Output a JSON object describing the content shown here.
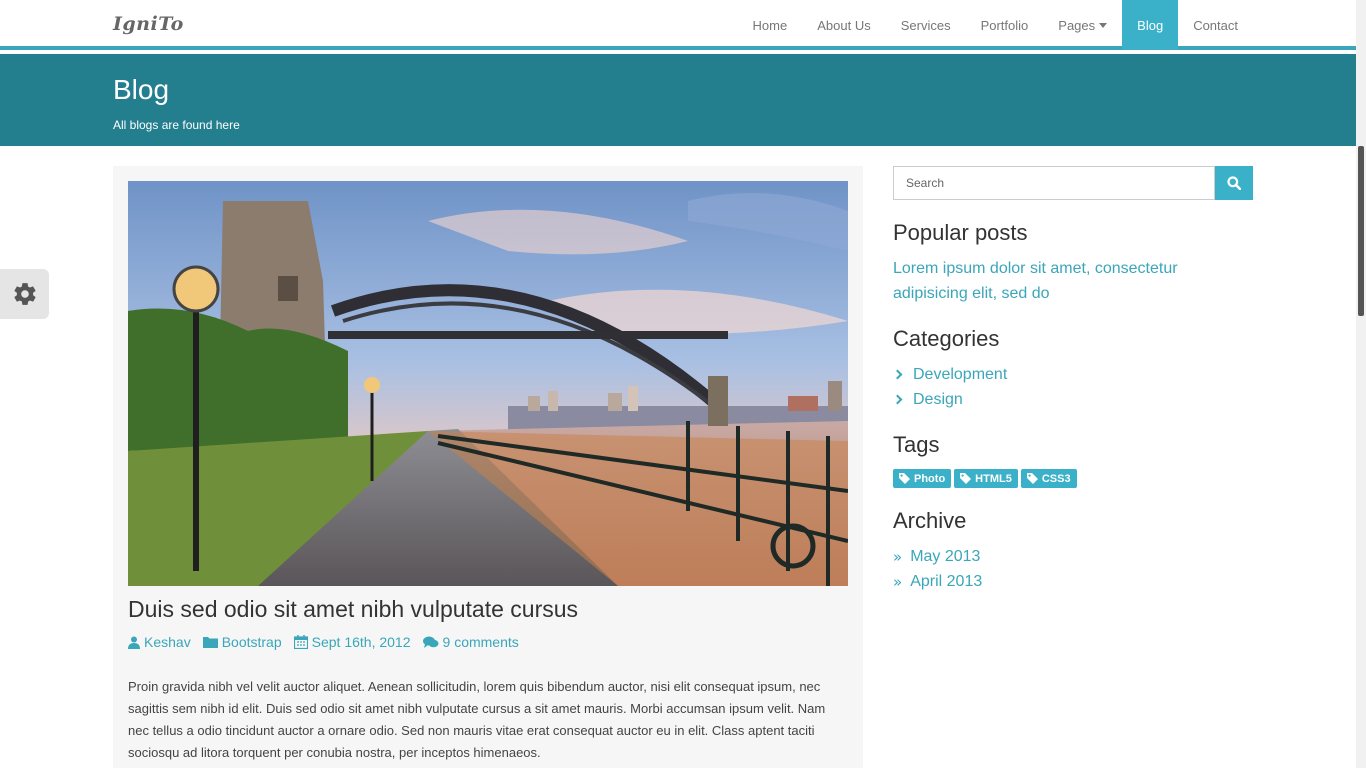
{
  "brand": "IgniTo",
  "nav": {
    "items": [
      {
        "label": "Home"
      },
      {
        "label": "About Us"
      },
      {
        "label": "Services"
      },
      {
        "label": "Portfolio"
      },
      {
        "label": "Pages"
      },
      {
        "label": "Blog"
      },
      {
        "label": "Contact"
      }
    ],
    "active": "Blog"
  },
  "header": {
    "title": "Blog",
    "subtitle": "All blogs are found here"
  },
  "post": {
    "title": "Duis sed odio sit amet nibh vulputate cursus",
    "author": "Keshav",
    "category": "Bootstrap",
    "date": "Sept 16th, 2012",
    "comments": "9 comments",
    "body": "Proin gravida nibh vel velit auctor aliquet. Aenean sollicitudin, lorem quis bibendum auctor, nisi elit consequat ipsum, nec sagittis sem nibh id elit. Duis sed odio sit amet nibh vulputate cursus a sit amet mauris. Morbi accumsan ipsum velit. Nam nec tellus a odio tincidunt auctor a ornare odio. Sed non mauris vitae erat consequat auctor eu in elit. Class aptent taciti sociosqu ad litora torquent per conubia nostra, per inceptos himenaeos."
  },
  "sidebar": {
    "search_placeholder": "Search",
    "popular_title": "Popular posts",
    "popular_link": "Lorem ipsum dolor sit amet, consectetur adipisicing elit, sed do",
    "categories_title": "Categories",
    "categories": [
      "Development",
      "Design"
    ],
    "tags_title": "Tags",
    "tags": [
      "Photo",
      "HTML5",
      "CSS3"
    ],
    "archive_title": "Archive",
    "archive": [
      "May 2013",
      "April 2013"
    ]
  },
  "colors": {
    "accent": "#3ab1c8",
    "header_band": "#237e8e",
    "link": "#3aa6b9"
  },
  "icons": {
    "settings": "gear-icon",
    "search": "search-icon",
    "author": "user-icon",
    "category": "folder-icon",
    "date": "calendar-icon",
    "comments": "comments-icon",
    "tag": "tag-icon"
  }
}
